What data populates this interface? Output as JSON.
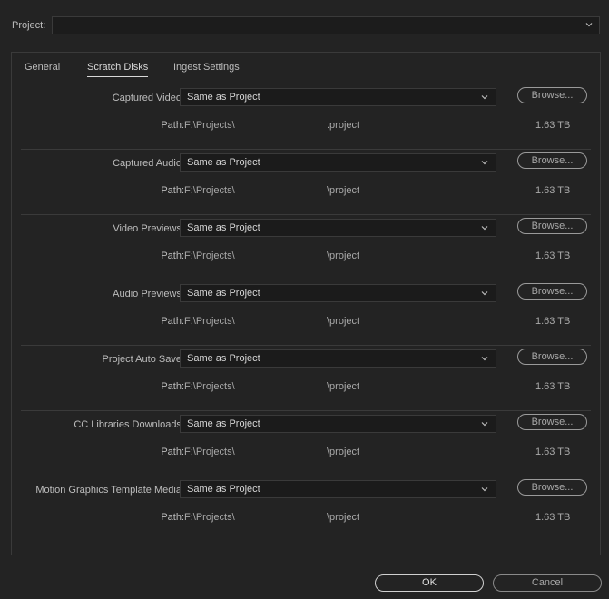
{
  "project": {
    "label": "Project:",
    "value": ""
  },
  "tabs": [
    {
      "label": "General",
      "active": false
    },
    {
      "label": "Scratch Disks",
      "active": true
    },
    {
      "label": "Ingest Settings",
      "active": false
    }
  ],
  "path_label": "Path:",
  "browse_label": "Browse...",
  "rows": [
    {
      "label": "Captured Video:",
      "select": "Same as Project",
      "path": "F:\\Projects\\",
      "path_tail": ".project",
      "size": "1.63 TB"
    },
    {
      "label": "Captured Audio:",
      "select": "Same as Project",
      "path": "F:\\Projects\\",
      "path_tail": "\\project",
      "size": "1.63 TB"
    },
    {
      "label": "Video Previews:",
      "select": "Same as Project",
      "path": "F:\\Projects\\",
      "path_tail": "\\project",
      "size": "1.63 TB"
    },
    {
      "label": "Audio Previews:",
      "select": "Same as Project",
      "path": "F:\\Projects\\",
      "path_tail": "\\project",
      "size": "1.63 TB"
    },
    {
      "label": "Project Auto Save:",
      "select": "Same as Project",
      "path": "F:\\Projects\\",
      "path_tail": "\\project",
      "size": "1.63 TB"
    },
    {
      "label": "CC Libraries Downloads:",
      "select": "Same as Project",
      "path": "F:\\Projects\\",
      "path_tail": "\\project",
      "size": "1.63 TB"
    },
    {
      "label": "Motion Graphics Template Media:",
      "select": "Same as Project",
      "path": "F:\\Projects\\",
      "path_tail": "\\project",
      "size": "1.63 TB"
    }
  ],
  "footer": {
    "ok_label": "OK",
    "cancel_label": "Cancel"
  }
}
